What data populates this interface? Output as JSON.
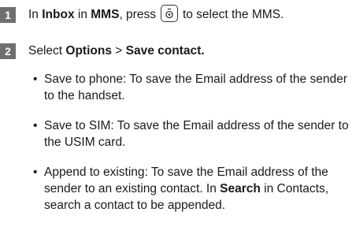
{
  "steps": [
    {
      "number": "1",
      "parts": {
        "t1": "In ",
        "b1": "Inbox",
        "t2": " in ",
        "b2": "MMS",
        "t3": ", press",
        "icon": "center-key-icon",
        "t4": "to select the MMS."
      }
    },
    {
      "number": "2",
      "parts": {
        "t1": "Select ",
        "b1": "Options",
        "t2": " > ",
        "b2": "Save contact."
      }
    }
  ],
  "bullets": [
    {
      "text": "Save to phone: To save the Email address of the sender to the handset."
    },
    {
      "text": "Save to SIM: To save the Email address of the sender to the USIM card."
    },
    {
      "t1": "Append to existing: To save the Email address of the sender to an existing contact. In ",
      "b1": "Search",
      "t2": " in Contacts, search a contact to be appended."
    }
  ]
}
